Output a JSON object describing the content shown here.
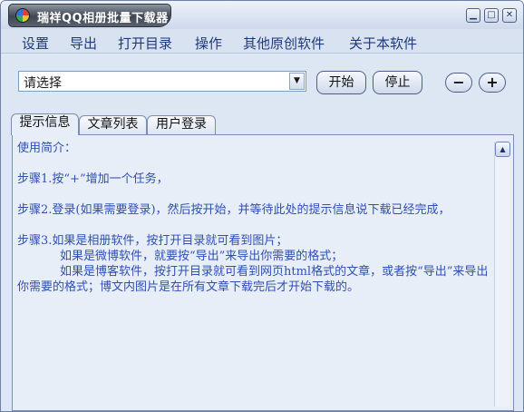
{
  "window": {
    "title": "瑞祥QQ相册批量下载器",
    "minimize": "▁",
    "maximize": "□",
    "close": "✕"
  },
  "menu": {
    "items": [
      "设置",
      "导出",
      "打开目录",
      "操作",
      "其他原创软件",
      "关于本软件"
    ]
  },
  "toolbar": {
    "select_value": "请选择",
    "start": "开始",
    "stop": "停止",
    "remove": "−",
    "add": "+"
  },
  "tabs": {
    "items": [
      "提示信息",
      "文章列表",
      "用户登录"
    ],
    "active": 0
  },
  "info": {
    "intro": "使用简介：",
    "step1": "步骤1.按“+”增加一个任务，",
    "step2": "步骤2.登录(如果需要登录)，然后按开始，并等待此处的提示信息说下载已经完成，",
    "step3a": "步骤3.如果是相册软件，按打开目录就可看到图片；",
    "step3b": "如果是微博软件，就要按“导出”来导出你需要的格式；",
    "step3c": "如果是博客软件，按打开目录就可看到网页html格式的文章，或者按“导出”来导出你需要的格式；博文内图片是在所有文章下载完后才开始下载的。"
  }
}
